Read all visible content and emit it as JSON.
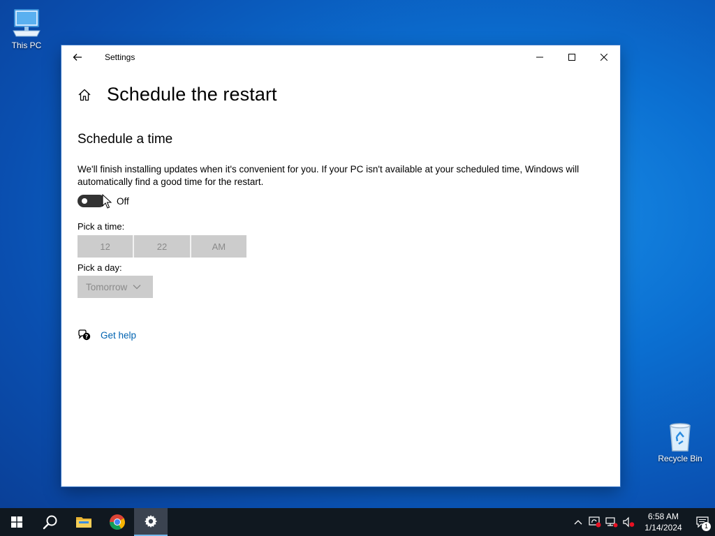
{
  "desktop": {
    "icons": [
      {
        "label": "This PC"
      },
      {
        "label": "Recycle Bin"
      }
    ]
  },
  "window": {
    "title": "Settings",
    "page_title": "Schedule the restart",
    "section_title": "Schedule a time",
    "description": "We'll finish installing updates when it's convenient for you. If your PC isn't available at your scheduled time, Windows will automatically find a good time for the restart.",
    "toggle": {
      "state": "Off",
      "on": false
    },
    "pick_time_label": "Pick a time:",
    "time": {
      "hour": "12",
      "minute": "22",
      "period": "AM"
    },
    "pick_day_label": "Pick a day:",
    "day": "Tomorrow",
    "help_link": "Get help"
  },
  "taskbar": {
    "items": [
      "start",
      "search",
      "file-explorer",
      "chrome",
      "settings"
    ],
    "active": "settings",
    "clock": {
      "time": "6:58 AM",
      "date": "1/14/2024"
    },
    "notification_count": "1"
  },
  "colors": {
    "accent": "#0063b1",
    "disabled_bg": "#cccccc",
    "disabled_text": "#8a8a8a",
    "taskbar": "#101820"
  }
}
